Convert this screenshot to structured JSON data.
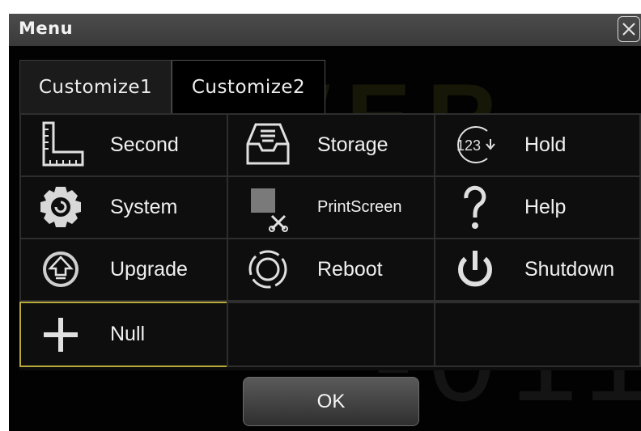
{
  "dialog": {
    "title": "Menu",
    "close_icon": "close-icon"
  },
  "tabs": [
    {
      "label": "Customize1",
      "selected": false
    },
    {
      "label": "Customize2",
      "selected": true
    }
  ],
  "items": [
    {
      "label": "Second",
      "icon": "ruler-icon"
    },
    {
      "label": "Storage",
      "icon": "storage-tray-icon"
    },
    {
      "label": "Hold",
      "icon": "hold-123-icon"
    },
    {
      "label": "System",
      "icon": "gear-icon"
    },
    {
      "label": "PrintScreen",
      "icon": "print-screen-icon"
    },
    {
      "label": "Help",
      "icon": "question-mark-icon"
    },
    {
      "label": "Upgrade",
      "icon": "upgrade-arrow-icon"
    },
    {
      "label": "Reboot",
      "icon": "reboot-icon"
    },
    {
      "label": "Shutdown",
      "icon": "power-icon"
    },
    {
      "label": "Null",
      "icon": "plus-icon",
      "selected": true
    }
  ],
  "ok_label": "OK",
  "colors": {
    "selection_border": "#b7aa3a",
    "background": "#020202",
    "titlebar": "#444444"
  }
}
